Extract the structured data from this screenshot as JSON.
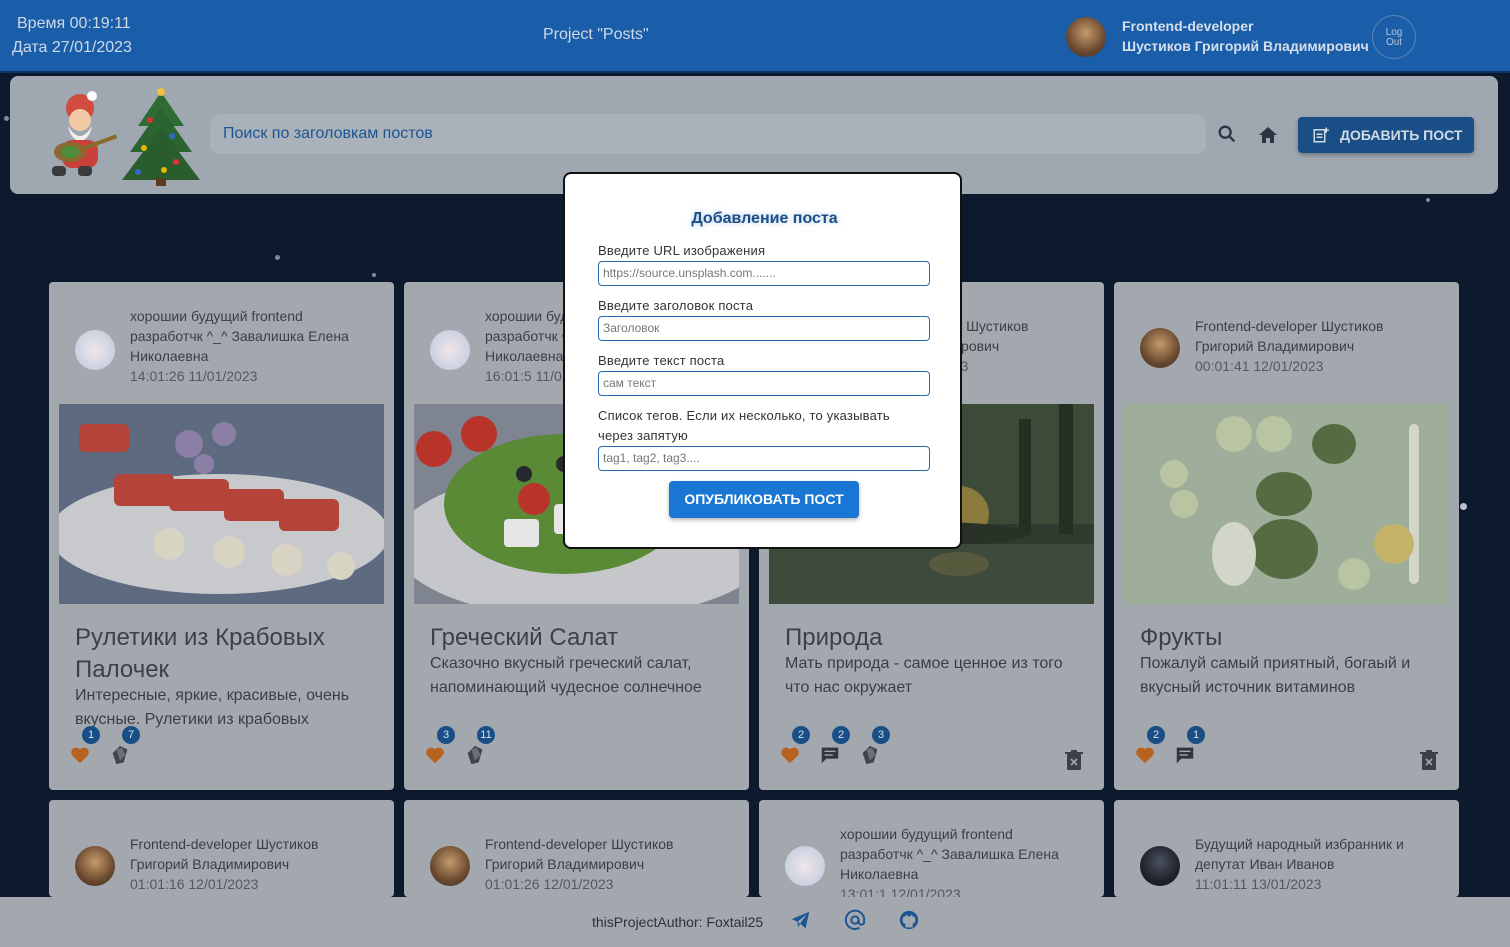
{
  "header": {
    "time_label": "Время 00:19:11",
    "date_label": "Дата 27/01/2023",
    "project_title": "Project \"Posts\"",
    "user_role": "Frontend-developer",
    "user_name": "Шустиков Григорий Владимирович",
    "logout_line1": "Log",
    "logout_line2": "Out"
  },
  "toolbar": {
    "search_placeholder": "Поиск по заголовкам постов",
    "add_post_label": "ДОБАВИТЬ ПОСТ"
  },
  "posts": [
    {
      "author": "хороши будущий frontend разработчк ^_^ Завалишка Елена Николаевна",
      "author_text": "хорошии будущий frontend разработчк ^_^ Завалишка Елена Николаевна",
      "date": "14:01:26 11/01/2023",
      "title": "Рулетики из Крабовых Палочек",
      "text": "Интересные, яркие, красивые, очень вкусные. Рулетики из крабовых",
      "likes": "1",
      "comments": null,
      "tags": "7"
    },
    {
      "author_text": "хорошии будущий frontend разработчк ^_^ Завалишка Елена Николаевна",
      "date": "16:01:5 11/01/2023",
      "title": "Греческий Салат",
      "text": "Сказочно вкусный греческий салат, напоминающий чудесное солнечное",
      "likes": "3",
      "tags": "11"
    },
    {
      "author_text": "Frontend-developer Шустиков Григорий Владимирович",
      "date": "00:01:23 12/01/2023",
      "title": "Природа",
      "text": "Мать природа - самое ценное из того что нас окружает",
      "likes": "2",
      "comments": "2",
      "tags": "3"
    },
    {
      "author_text": "Frontend-developer Шустиков Григорий Владимирович",
      "date": "00:01:41 12/01/2023",
      "title": "Фрукты",
      "text": "Пожалуй самый приятный, богаый и вкусный источник витаминов",
      "likes": "2",
      "comments": "1"
    },
    {
      "author_text": "Frontend-developer Шустиков Григорий Владимирович",
      "date": "01:01:16 12/01/2023"
    },
    {
      "author_text": "Frontend-developer Шустиков Григорий Владимирович",
      "date": "01:01:26 12/01/2023"
    },
    {
      "author_text": "хорошии будущий frontend разработчк ^_^ Завалишка Елена Николаевна",
      "date": "13:01:1 12/01/2023"
    },
    {
      "author_text": "Будущий народный избранник и депутат Иван Иванов",
      "date": "11:01:11 13/01/2023"
    }
  ],
  "modal": {
    "title": "Добавление поста",
    "url_label": "Введите URL изображения",
    "url_placeholder": "https://source.unsplash.com.......",
    "title_label": "Введите заголовок поста",
    "title_placeholder": "Заголовок",
    "text_label": "Введите текст поста",
    "text_placeholder": "сам текст",
    "tags_label": "Список тегов. Если их несколько, то указывать через запятую",
    "tags_placeholder": "tag1, tag2, tag3....",
    "publish_label": "ОПУБЛИКОВАТЬ ПОСТ"
  },
  "footer": {
    "author_label": "thisProjectAuthor: Foxtail25"
  },
  "icons": {
    "search": "search-icon",
    "home": "home-icon",
    "add_post": "post-add-icon",
    "like": "heart-icon",
    "comment": "comment-icon",
    "tag": "tag-icon",
    "delete": "trash-icon",
    "telegram": "telegram-icon",
    "email": "at-sign-icon",
    "github": "github-icon"
  }
}
